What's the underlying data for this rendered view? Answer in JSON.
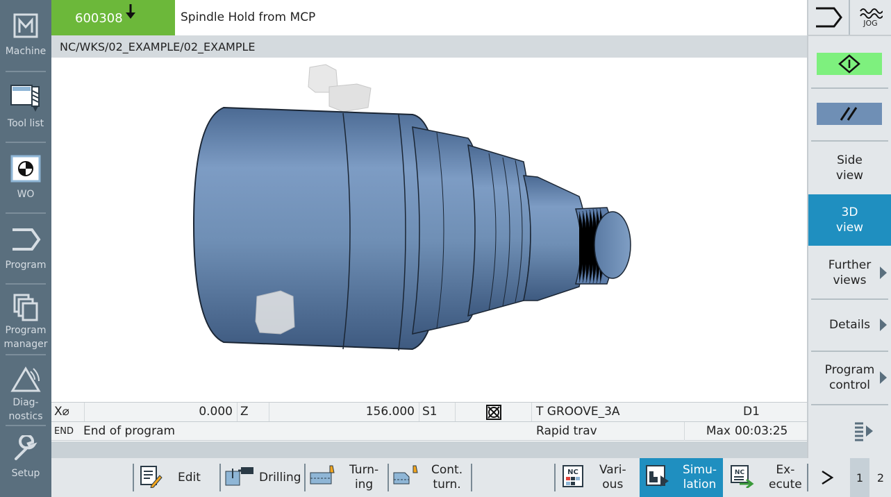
{
  "sidebar": {
    "items": [
      {
        "label": "Machine",
        "icon": "machine-icon"
      },
      {
        "label": "Tool list",
        "icon": "tool-list-icon"
      },
      {
        "label": "WO",
        "icon": "work-offset-icon"
      },
      {
        "label": "Program",
        "icon": "program-icon"
      },
      {
        "label": "Program manager",
        "icon": "program-manager-icon"
      },
      {
        "label": "Diag-nostics",
        "icon": "diagnostics-icon"
      },
      {
        "label": "Setup",
        "icon": "wrench-icon"
      }
    ]
  },
  "header": {
    "alarm_code": "600308",
    "alarm_text": "Spindle Hold from MCP",
    "path": "NC/WKS/02_EXAMPLE/02_EXAMPLE",
    "mode": "JOG"
  },
  "position_row": {
    "x_axis": "X⌀",
    "x_value": "0.000",
    "z_axis": "Z",
    "z_value": "156.000",
    "spindle": "S1",
    "tool": "T GROOVE_3A",
    "offset": "D1"
  },
  "status_row": {
    "block": "END",
    "message": "End of program",
    "feed_mode": "Rapid trav",
    "time_label": "Max",
    "time_value": "00:03:25"
  },
  "right_softkeys": {
    "side_view": [
      "Side",
      "view"
    ],
    "view_3d": [
      "3D",
      "view"
    ],
    "further_views": [
      "Further",
      "views"
    ],
    "details": "Details",
    "program_control": [
      "Program",
      "control"
    ]
  },
  "bottom_softkeys": {
    "edit": "Edit",
    "drilling": "Drilling",
    "turning": [
      "Turn-",
      "ing"
    ],
    "cont_turn": [
      "Cont.",
      "turn."
    ],
    "various": [
      "Vari-",
      "ous"
    ],
    "simulation": [
      "Simu-",
      "lation"
    ],
    "execute": [
      "Ex-",
      "ecute"
    ],
    "page_1": "1",
    "page_2": "2",
    "nc_badge": "NC"
  },
  "colors": {
    "sidebar_bg": "#5a6f7e",
    "alarm_green": "#6cb83a",
    "active_blue": "#1f8fc0",
    "part_blue": "#6f8fb5",
    "cycle_start_green": "#7ef07e"
  }
}
